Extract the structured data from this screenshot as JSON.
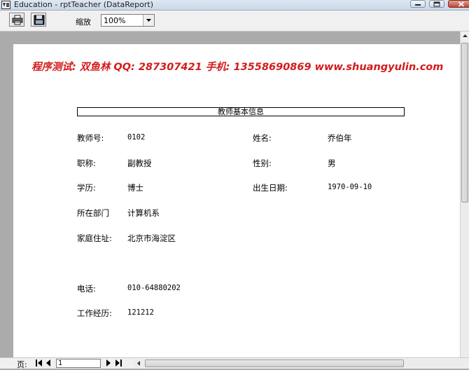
{
  "window": {
    "title": "Education - rptTeacher (DataReport)"
  },
  "icons": {
    "app": "report-app-icon",
    "print": "printer-icon",
    "export": "export-disk-icon",
    "minimize": "minimize-icon",
    "maximize": "maximize-icon",
    "close": "close-icon"
  },
  "toolbar": {
    "zoom_label": "缩放",
    "zoom_value": "100%"
  },
  "report": {
    "banner": "程序测试: 双鱼林   QQ: 287307421 手机: 13558690869   www.shuangyulin.com",
    "banner_color": "#d41c1c",
    "title": "教师基本信息",
    "fields": {
      "teacher_no_label": "教师号:",
      "teacher_no": "0102",
      "name_label": "姓名:",
      "name": "乔伯年",
      "title_label": "职称:",
      "title": "副教授",
      "gender_label": "性别:",
      "gender": "男",
      "education_label": "学历:",
      "education": "博士",
      "birth_label": "出生日期:",
      "birth": "1970-09-10",
      "dept_label": "所在部门",
      "dept": "计算机系",
      "address_label": "家庭住址:",
      "address": "北京市海淀区",
      "phone_label": "电话:",
      "phone": "010-64880202",
      "experience_label": "工作经历:",
      "experience": "121212"
    }
  },
  "navigator": {
    "page_label": "页:",
    "page_value": "1"
  }
}
